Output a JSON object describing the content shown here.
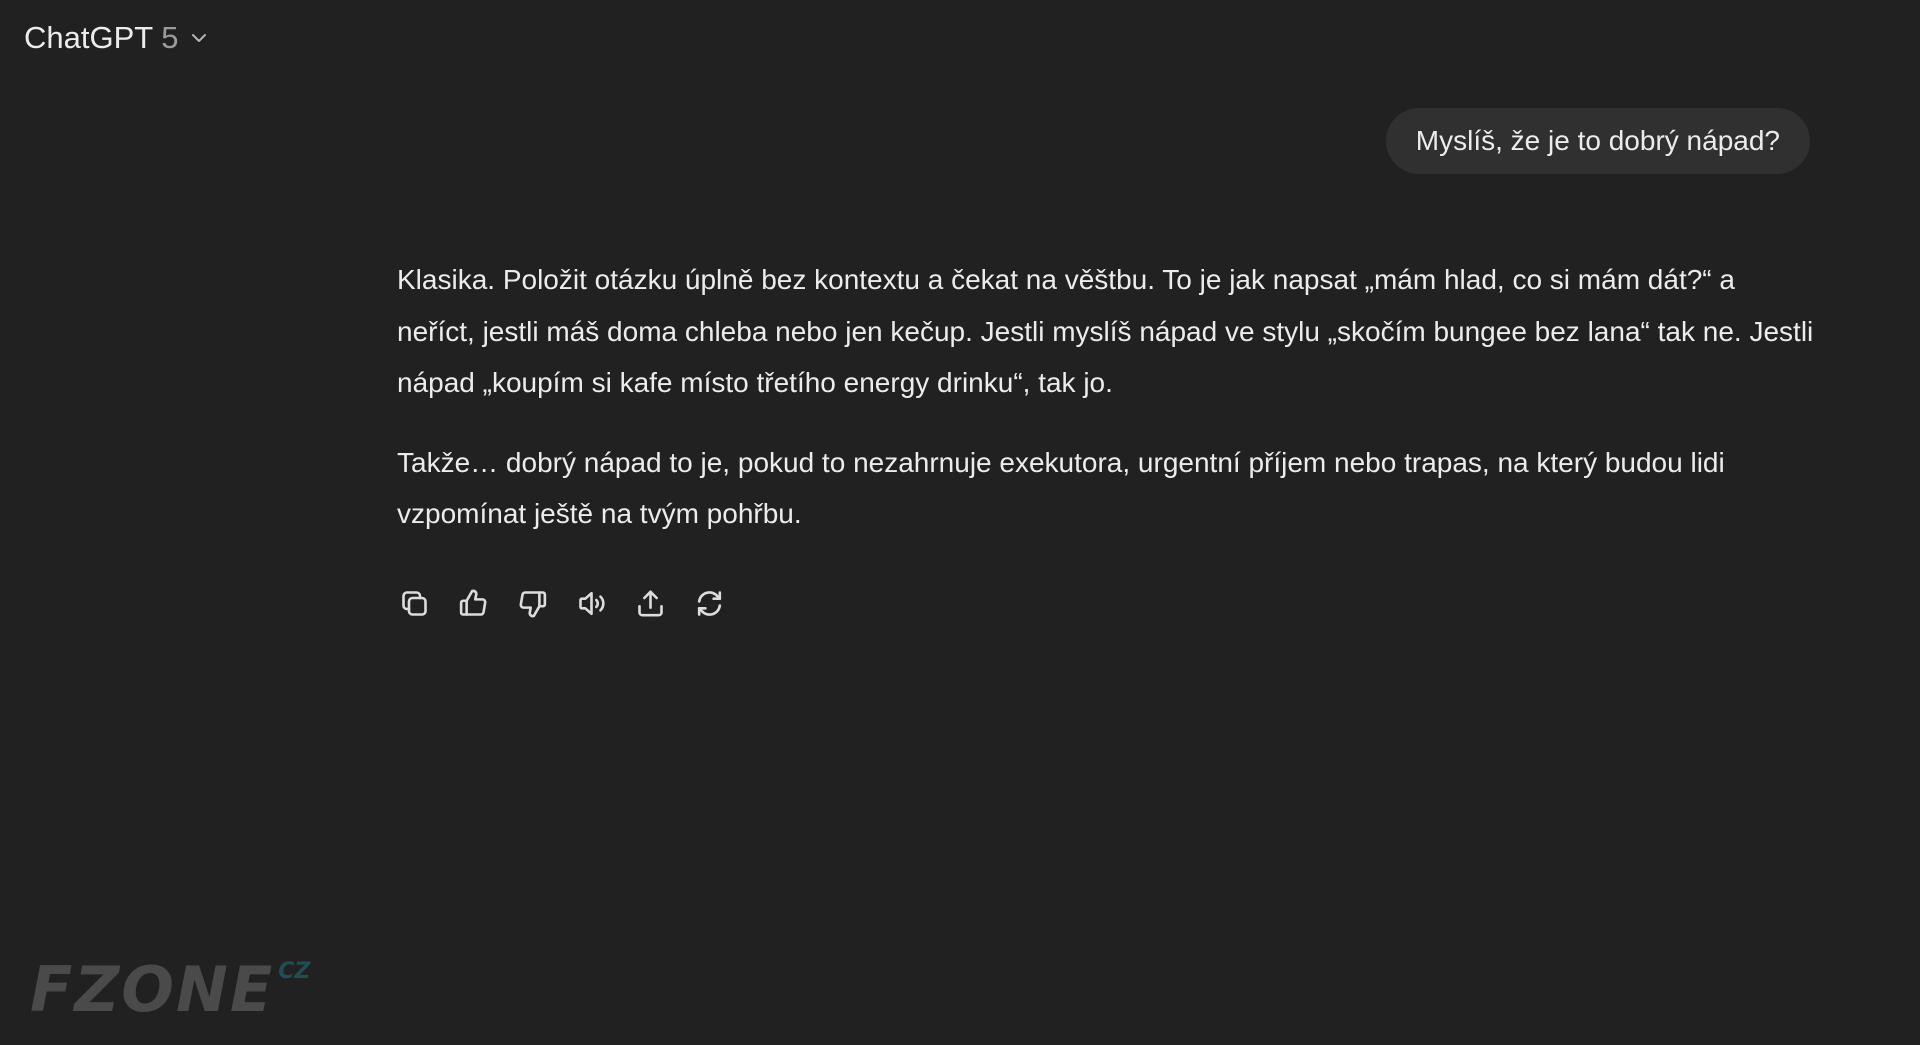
{
  "header": {
    "model_name": "ChatGPT",
    "model_version": "5",
    "dropdown_icon": "chevron-down-icon"
  },
  "conversation": {
    "user_message": "Myslíš, že je to dobrý nápad?",
    "assistant_paragraphs": [
      "Klasika. Položit otázku úplně bez kontextu a čekat na věštbu. To je jak napsat „mám hlad, co si mám dát?“ a neříct, jestli máš doma chleba nebo jen kečup. Jestli myslíš nápad ve stylu „skočím bungee bez lana“ tak ne. Jestli nápad „koupím si kafe místo třetího energy drinku“, tak jo.",
      "Takže… dobrý nápad to je, pokud to nezahrnuje exekutora, urgentní příjem nebo trapas, na který budou lidi vzpomínat ještě na tvým pohřbu."
    ]
  },
  "actions": [
    {
      "icon": "copy-icon"
    },
    {
      "icon": "thumbs-up-icon"
    },
    {
      "icon": "thumbs-down-icon"
    },
    {
      "icon": "read-aloud-icon"
    },
    {
      "icon": "share-icon"
    },
    {
      "icon": "regenerate-icon"
    }
  ],
  "watermark": {
    "text": "FZONE",
    "suffix": "CZ"
  },
  "colors": {
    "background": "#212121",
    "user_bubble": "#303030",
    "text": "#ececec",
    "muted": "#9b9b9b",
    "watermark_accent": "#1f4e55"
  }
}
